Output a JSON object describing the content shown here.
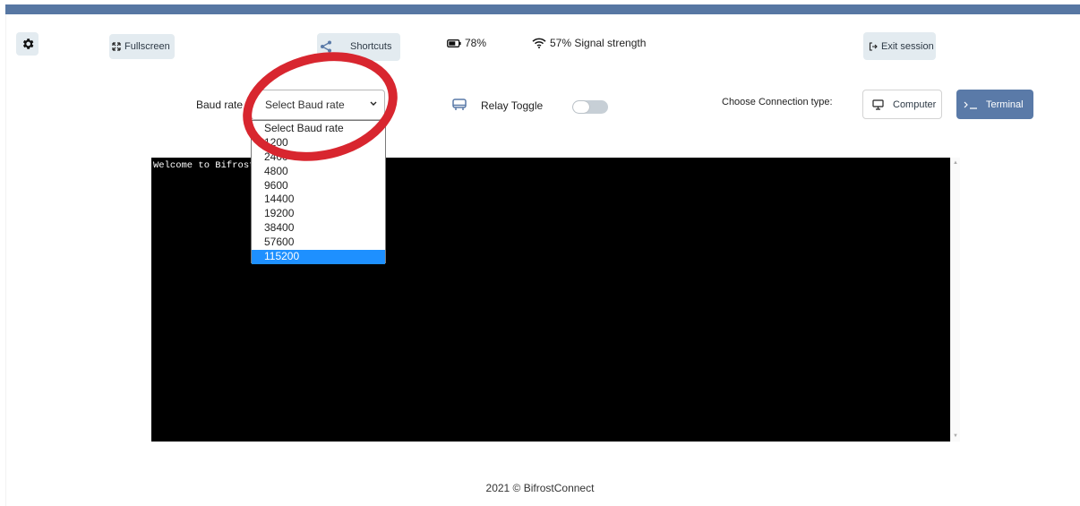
{
  "header": {
    "fullscreen_label": "Fullscreen",
    "shortcuts_label": "Shortcuts",
    "battery": "78%",
    "signal": "57% Signal strength",
    "exit_label": "Exit session"
  },
  "controls": {
    "baud_label": "Baud rate",
    "baud_selected": "Select Baud rate",
    "baud_options": [
      "Select Baud rate",
      "1200",
      "2400",
      "4800",
      "9600",
      "14400",
      "19200",
      "38400",
      "57600",
      "115200"
    ],
    "highlighted_option": "115200",
    "relay_label": "Relay Toggle",
    "relay_on": false,
    "connection_label": "Choose Connection type:",
    "computer_label": "Computer",
    "terminal_label": "Terminal"
  },
  "terminal": {
    "text": "Welcome to BifrostConnect Terminal"
  },
  "footer": {
    "text": "2021 © BifrostConnect"
  },
  "colors": {
    "topbar": "#5777a3",
    "accent": "#5a7aa8",
    "button_bg": "#e3ebf0",
    "highlight": "#1e90ff",
    "annotation": "#d8262f"
  }
}
